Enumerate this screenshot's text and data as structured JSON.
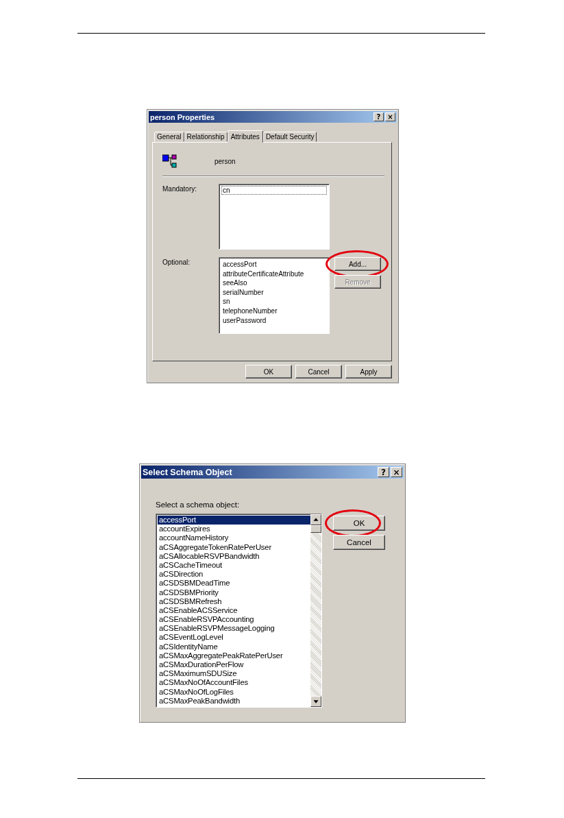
{
  "properties_dialog": {
    "title": "person Properties",
    "title_buttons": [
      "?",
      "×"
    ],
    "tabs": [
      {
        "label": "General",
        "selected": false
      },
      {
        "label": "Relationship",
        "selected": false
      },
      {
        "label": "Attributes",
        "selected": true
      },
      {
        "label": "Default Security",
        "selected": false
      }
    ],
    "class_name": "person",
    "mandatory": {
      "label": "Mandatory:",
      "items": [
        {
          "text": "cn",
          "focused": true
        }
      ]
    },
    "optional": {
      "label": "Optional:",
      "items": [
        {
          "text": "accessPort",
          "focused": false
        },
        {
          "text": "attributeCertificateAttribute",
          "focused": false
        },
        {
          "text": "seeAlso",
          "focused": false
        },
        {
          "text": "serialNumber",
          "focused": false
        },
        {
          "text": "sn",
          "focused": false
        },
        {
          "text": "telephoneNumber",
          "focused": false
        },
        {
          "text": "userPassword",
          "focused": false
        }
      ]
    },
    "side_buttons": [
      {
        "label": "Add...",
        "disabled": false,
        "highlighted": true
      },
      {
        "label": "Remove",
        "disabled": true,
        "highlighted": false
      }
    ],
    "buttons": [
      {
        "label": "OK",
        "disabled": false
      },
      {
        "label": "Cancel",
        "disabled": false
      },
      {
        "label": "Apply",
        "disabled": false
      }
    ]
  },
  "schema_dialog": {
    "title": "Select Schema Object",
    "title_buttons": [
      "?",
      "×"
    ],
    "label": "Select a schema object:",
    "items": [
      {
        "text": "accessPort",
        "selected": true
      },
      {
        "text": "accountExpires",
        "selected": false
      },
      {
        "text": "accountNameHistory",
        "selected": false
      },
      {
        "text": "aCSAggregateTokenRatePerUser",
        "selected": false
      },
      {
        "text": "aCSAllocableRSVPBandwidth",
        "selected": false
      },
      {
        "text": "aCSCacheTimeout",
        "selected": false
      },
      {
        "text": "aCSDirection",
        "selected": false
      },
      {
        "text": "aCSDSBMDeadTime",
        "selected": false
      },
      {
        "text": "aCSDSBMPriority",
        "selected": false
      },
      {
        "text": "aCSDSBMRefresh",
        "selected": false
      },
      {
        "text": "aCSEnableACSService",
        "selected": false
      },
      {
        "text": "aCSEnableRSVPAccounting",
        "selected": false
      },
      {
        "text": "aCSEnableRSVPMessageLogging",
        "selected": false
      },
      {
        "text": "aCSEventLogLevel",
        "selected": false
      },
      {
        "text": "aCSIdentityName",
        "selected": false
      },
      {
        "text": "aCSMaxAggregatePeakRatePerUser",
        "selected": false
      },
      {
        "text": "aCSMaxDurationPerFlow",
        "selected": false
      },
      {
        "text": "aCSMaximumSDUSize",
        "selected": false
      },
      {
        "text": "aCSMaxNoOfAccountFiles",
        "selected": false
      },
      {
        "text": "aCSMaxNoOfLogFiles",
        "selected": false
      },
      {
        "text": "aCSMaxPeakBandwidth",
        "selected": false
      }
    ],
    "buttons": [
      {
        "label": "OK",
        "highlighted": true
      },
      {
        "label": "Cancel",
        "highlighted": false
      }
    ]
  }
}
